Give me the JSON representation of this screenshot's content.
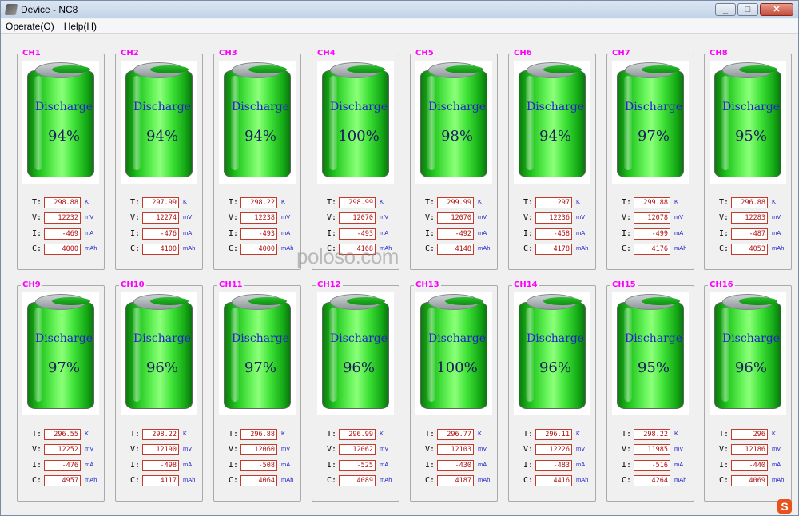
{
  "window": {
    "title": "Device - NC8"
  },
  "menu": [
    {
      "label": "Operate(O)"
    },
    {
      "label": "Help(H)"
    }
  ],
  "units": {
    "T": "K",
    "V": "mV",
    "I": "mA",
    "C": "mAh"
  },
  "labels": {
    "T": "T:",
    "V": "V:",
    "I": "I:",
    "C": "C:"
  },
  "channels": [
    {
      "name": "CH1",
      "status": "Discharge",
      "percent": "94%",
      "T": "298.88",
      "V": "12232",
      "I": "-469",
      "C": "4000"
    },
    {
      "name": "CH2",
      "status": "Discharge",
      "percent": "94%",
      "T": "297.99",
      "V": "12274",
      "I": "-476",
      "C": "4100"
    },
    {
      "name": "CH3",
      "status": "Discharge",
      "percent": "94%",
      "T": "298.22",
      "V": "12238",
      "I": "-493",
      "C": "4000"
    },
    {
      "name": "CH4",
      "status": "Discharge",
      "percent": "100%",
      "T": "298.99",
      "V": "12070",
      "I": "-493",
      "C": "4168"
    },
    {
      "name": "CH5",
      "status": "Discharge",
      "percent": "98%",
      "T": "299.99",
      "V": "12070",
      "I": "-492",
      "C": "4148"
    },
    {
      "name": "CH6",
      "status": "Discharge",
      "percent": "94%",
      "T": "297",
      "V": "12236",
      "I": "-458",
      "C": "4178"
    },
    {
      "name": "CH7",
      "status": "Discharge",
      "percent": "97%",
      "T": "299.88",
      "V": "12078",
      "I": "-499",
      "C": "4176"
    },
    {
      "name": "CH8",
      "status": "Discharge",
      "percent": "95%",
      "T": "296.88",
      "V": "12283",
      "I": "-487",
      "C": "4053"
    },
    {
      "name": "CH9",
      "status": "Discharge",
      "percent": "97%",
      "T": "296.55",
      "V": "12252",
      "I": "-476",
      "C": "4957"
    },
    {
      "name": "CH10",
      "status": "Discharge",
      "percent": "96%",
      "T": "298.22",
      "V": "12190",
      "I": "-498",
      "C": "4117"
    },
    {
      "name": "CH11",
      "status": "Discharge",
      "percent": "97%",
      "T": "296.88",
      "V": "12060",
      "I": "-508",
      "C": "4064"
    },
    {
      "name": "CH12",
      "status": "Discharge",
      "percent": "96%",
      "T": "296.99",
      "V": "12062",
      "I": "-525",
      "C": "4089"
    },
    {
      "name": "CH13",
      "status": "Discharge",
      "percent": "100%",
      "T": "296.77",
      "V": "12103",
      "I": "-430",
      "C": "4187"
    },
    {
      "name": "CH14",
      "status": "Discharge",
      "percent": "96%",
      "T": "296.11",
      "V": "12226",
      "I": "-483",
      "C": "4416"
    },
    {
      "name": "CH15",
      "status": "Discharge",
      "percent": "95%",
      "T": "298.22",
      "V": "11985",
      "I": "-516",
      "C": "4264"
    },
    {
      "name": "CH16",
      "status": "Discharge",
      "percent": "96%",
      "T": "296",
      "V": "12186",
      "I": "-440",
      "C": "4069"
    }
  ],
  "watermark": "poloso.com"
}
